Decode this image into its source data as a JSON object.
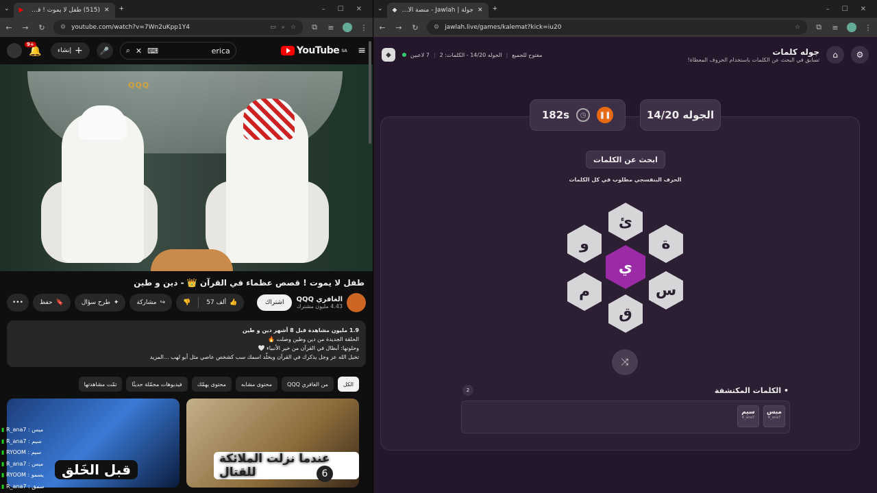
{
  "left": {
    "tab_title": "(515) طفل لا يموت ! قصص ...",
    "url": "youtube.com/watch?v=7Wn2uKpp1Y4",
    "yt": {
      "notif_count": "9+",
      "create_label": "إنشاء",
      "search_query": "erica",
      "logo_text": "YouTube",
      "region": "SA",
      "video_logo": "QQQ",
      "title": "طفل لا يموت ! قصص عظماء في القرآن 👑 - دين و طين",
      "channel": "الغافري QQQ",
      "subs": "4.43 مليون مشترك",
      "subscribe": "اشتراك",
      "likes": "57 ألف",
      "share": "مشاركة",
      "ask": "طرح سؤال",
      "save": "حفظ",
      "desc_lines": [
        "1.9 مليون مشاهدة  قبل 8 أشهر  دين و طين",
        "الحلقة الجديدة من دين وطين وصلت 🔥",
        "وحلونها: أبطال في القرآن من خير الأنبياء 🤍",
        "تخيل الله عز وجل يذكرك في القرآن ويخلّد اسمك سب كشخص عاصي مثل أبو لهب ...المزيد"
      ],
      "chips": [
        "الكل",
        "من الغافري QQQ",
        "محتوى مشابه",
        "محتوى يهمّك",
        "فيديوهات محمّلة حديثًا",
        "تمّت مشاهدتها"
      ],
      "thumb_a_caption": "قبل الخَلق",
      "thumb_b_caption": "عندما نزلت الملائكة للقتال",
      "thumb_b_number": "6",
      "chat": [
        [
          "R_ana7",
          "ميس"
        ],
        [
          "R_ana7",
          "سيم"
        ],
        [
          "RYOOM",
          "سيم"
        ],
        [
          "R_ana7",
          "ميس"
        ],
        [
          "RYOOM",
          "يسمو"
        ],
        [
          "R_ana7",
          "سمق"
        ]
      ]
    }
  },
  "right": {
    "tab_title": "جولة | Jawlah - منصة الألعاب الذ...",
    "url": "jawlah.live/games/kalemat?kick=iu20",
    "game_title": "جوله كلمات",
    "game_sub": "تسابق في البحث عن الكلمات باستخدام الحروف المعطاة!",
    "players": "7 لاعبين",
    "round_info": "الجوله 14/20 - الكلمات: 2",
    "open_label": "مفتوح للجميع",
    "timer": "182s",
    "round": "الجوله 14/20",
    "find_btn": "ابحث عن الكلمات",
    "hint": "الحرف البنفسجي مطلوب في كل الكلمات",
    "letters": {
      "center": "ي",
      "top": "ئ",
      "tr": "ة",
      "br": "س",
      "bottom": "ق",
      "bl": "م",
      "tl": "و"
    },
    "found_title": "الكلمات المكتشفة",
    "found_count": "2",
    "found_words": [
      {
        "word": "ميس",
        "user": "R_ana7"
      },
      {
        "word": "سيم",
        "user": "R_ana7"
      }
    ]
  },
  "colors": {
    "accent_purple": "#9b2aa6",
    "pause_orange": "#e86a14",
    "yt_red": "#ff0000",
    "online_green": "#33cc66"
  }
}
